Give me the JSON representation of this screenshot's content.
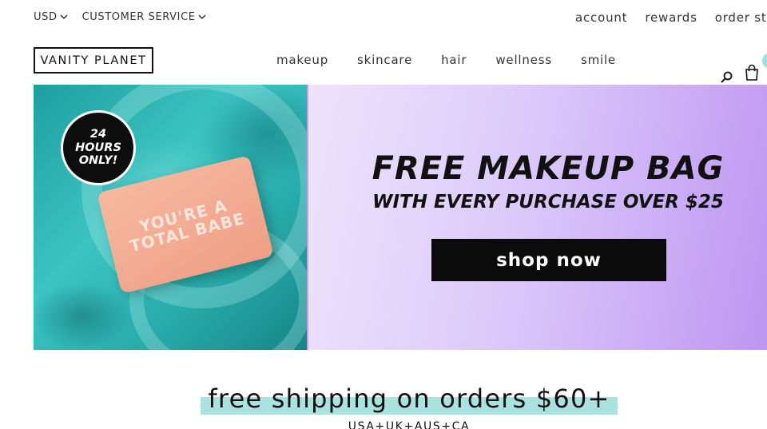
{
  "utility": {
    "currency": "USD",
    "customer_service": "CUSTOMER SERVICE",
    "links": [
      "account",
      "rewards",
      "order status"
    ]
  },
  "header": {
    "logo": "VANITY PLANET",
    "nav": [
      "makeup",
      "skincare",
      "hair",
      "wellness",
      "smile"
    ],
    "icons": [
      "search-icon",
      "bag-icon"
    ]
  },
  "hero": {
    "badge": "24\nHOURS\nONLY!",
    "pouch_text": "YOU'RE A\nTOTAL BABE",
    "title": "FREE MAKEUP BAG",
    "subtitle": "WITH EVERY PURCHASE OVER $25",
    "cta": "shop now"
  },
  "shipping": {
    "headline": "free shipping on orders $60+",
    "regions": "USA+UK+AUS+CA"
  },
  "colors": {
    "accent_teal": "#a9e2df",
    "hero_purple": "#c9a9f5",
    "button_black": "#0b0b0b"
  }
}
